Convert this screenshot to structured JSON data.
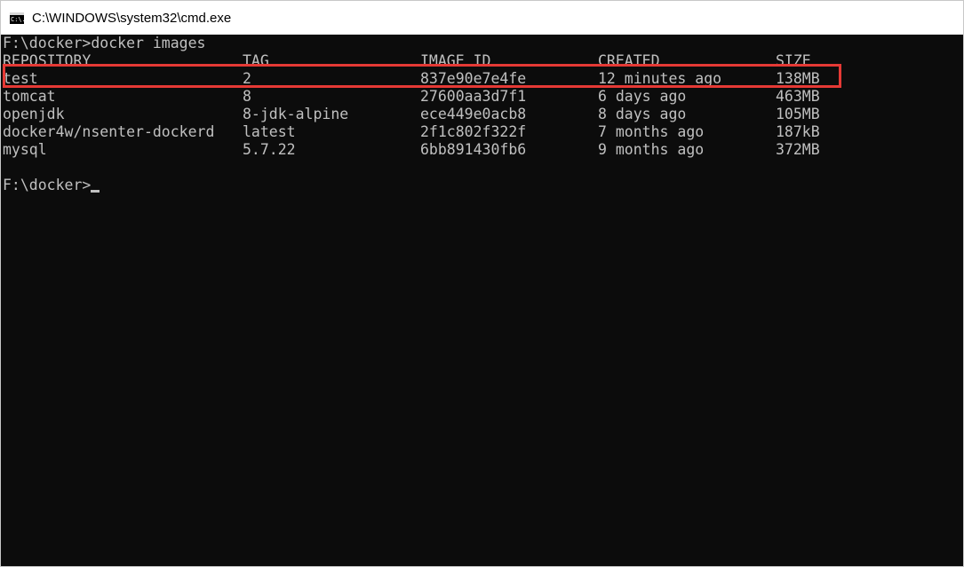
{
  "window": {
    "title": "C:\\WINDOWS\\system32\\cmd.exe",
    "app_icon_text": "C:\\."
  },
  "console": {
    "command_line": "F:\\docker>docker images",
    "headers": [
      "REPOSITORY",
      "TAG",
      "IMAGE ID",
      "CREATED",
      "SIZE"
    ],
    "rows": [
      [
        "test",
        "2",
        "837e90e7e4fe",
        "12 minutes ago",
        "138MB"
      ],
      [
        "tomcat",
        "8",
        "27600aa3d7f1",
        "6 days ago",
        "463MB"
      ],
      [
        "openjdk",
        "8-jdk-alpine",
        "ece449e0acb8",
        "8 days ago",
        "105MB"
      ],
      [
        "docker4w/nsenter-dockerd",
        "latest",
        "2f1c802f322f",
        "7 months ago",
        "187kB"
      ],
      [
        "mysql",
        "5.7.22",
        "6bb891430fb6",
        "9 months ago",
        "372MB"
      ]
    ],
    "prompt": "F:\\docker>"
  },
  "colors": {
    "console_bg": "#0c0c0c",
    "console_text": "#c0c0c0",
    "highlight_border": "#e53935"
  }
}
